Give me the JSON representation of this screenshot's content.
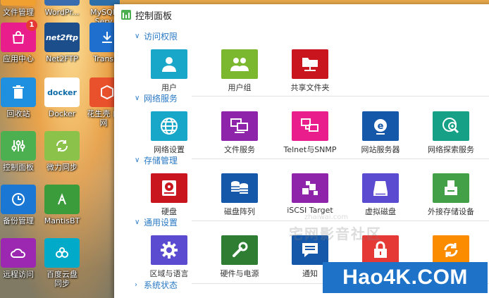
{
  "desktop": {
    "icons": [
      {
        "label": "文件管理",
        "color": "#f0a030"
      },
      {
        "label": "WordPr...",
        "color": "#3a6db0"
      },
      {
        "label": "MySQL Serv",
        "color": "#2c6fa8"
      },
      {
        "label": "应用中心",
        "color": "#e91e8c",
        "badge": "1"
      },
      {
        "label": "Net2FTP",
        "color": "#1d4e8c",
        "text": "net2ftp"
      },
      {
        "label": "Transm",
        "color": "#1f6fcf"
      },
      {
        "label": "回收站",
        "color": "#1f8fe0"
      },
      {
        "label": "Docker",
        "color": "#ffffff",
        "text": "docker"
      },
      {
        "label": "花生壳 内网",
        "color": "#e9502c"
      },
      {
        "label": "控制面板",
        "color": "#4caf50"
      },
      {
        "label": "微力同步",
        "color": "#8bc34a"
      },
      {
        "label": "备份管理",
        "color": "#1a78d4"
      },
      {
        "label": "MantisBT",
        "color": "#3a9c3a"
      },
      {
        "label": "远程访问",
        "color": "#9c27b0"
      },
      {
        "label": "百度云盘 同步",
        "color": "#00aac8"
      }
    ]
  },
  "window": {
    "title": "控制面板",
    "sections": [
      {
        "title": "访问权限",
        "apps": [
          {
            "label": "用户",
            "color": "#19a7c9",
            "icon": "user-icon"
          },
          {
            "label": "用户组",
            "color": "#7cb82f",
            "icon": "user-group-icon"
          },
          {
            "label": "共享文件夹",
            "color": "#c9151e",
            "icon": "shared-folder-icon"
          }
        ]
      },
      {
        "title": "网络服务",
        "apps": [
          {
            "label": "网络设置",
            "color": "#19a7c9",
            "icon": "globe-icon"
          },
          {
            "label": "文件服务",
            "color": "#8e24aa",
            "icon": "file-service-icon"
          },
          {
            "label": "Telnet与SNMP",
            "color": "#e91e8c",
            "icon": "telnet-icon"
          },
          {
            "label": "网站服务器",
            "color": "#1557a8",
            "icon": "web-server-icon"
          },
          {
            "label": "网络探索服务",
            "color": "#16a085",
            "icon": "network-discovery-icon"
          }
        ]
      },
      {
        "title": "存储管理",
        "apps": [
          {
            "label": "硬盘",
            "color": "#c9151e",
            "icon": "hard-disk-icon"
          },
          {
            "label": "磁盘阵列",
            "color": "#1557a8",
            "icon": "raid-icon"
          },
          {
            "label": "iSCSI Target",
            "color": "#8e24aa",
            "icon": "iscsi-icon"
          },
          {
            "label": "虚拟磁盘",
            "color": "#5b4bd0",
            "icon": "virtual-disk-icon"
          },
          {
            "label": "外接存储设备",
            "color": "#43a047",
            "icon": "external-storage-icon"
          }
        ]
      },
      {
        "title": "通用设置",
        "apps": [
          {
            "label": "区域与语言",
            "color": "#5b4bd0",
            "icon": "gear-icon"
          },
          {
            "label": "硬件与电源",
            "color": "#2e7d32",
            "icon": "wrench-icon"
          },
          {
            "label": "通知",
            "color": "#1557a8",
            "icon": "notification-icon"
          },
          {
            "label": "",
            "color": "#e53935",
            "icon": "lock-icon"
          },
          {
            "label": "",
            "color": "#fb8c00",
            "icon": "refresh-icon"
          }
        ]
      },
      {
        "title": "系统状态",
        "apps": []
      }
    ]
  },
  "overlay": {
    "watermark": "宅网影音社区",
    "watermark_small": "zhaiwai.com",
    "brand": "Hao4K.COM"
  }
}
